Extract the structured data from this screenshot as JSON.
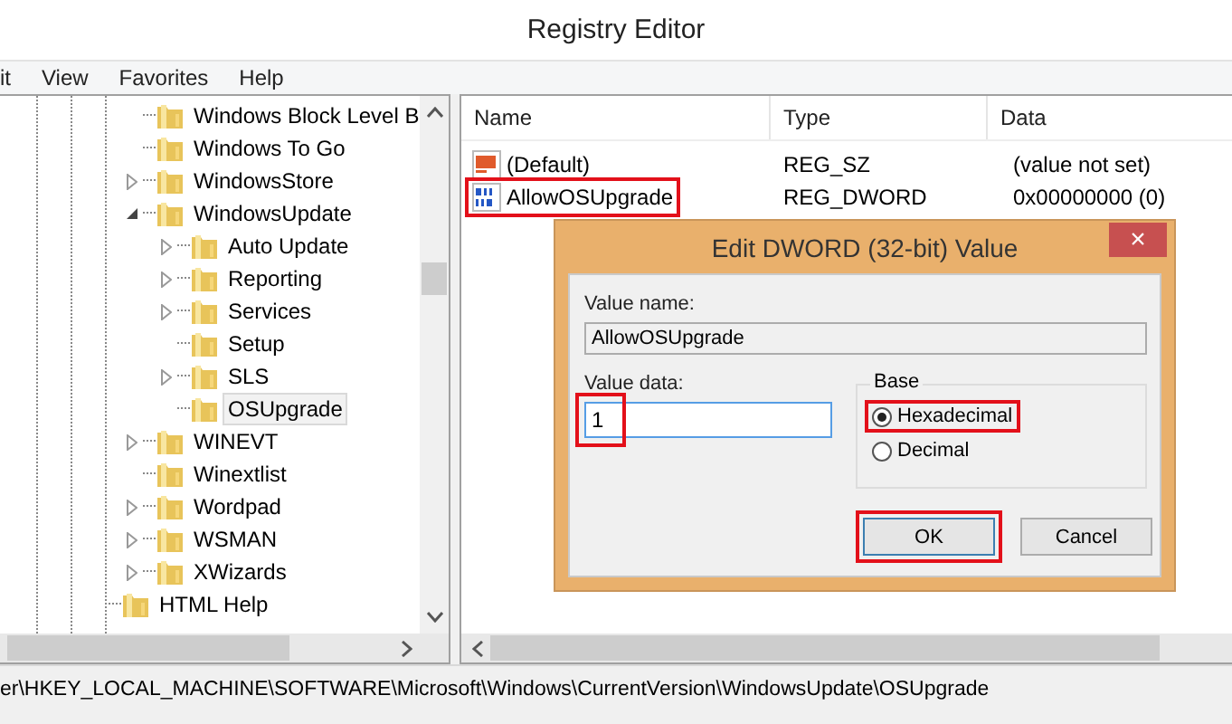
{
  "window": {
    "title": "Registry Editor"
  },
  "menu": [
    {
      "label": "it"
    },
    {
      "label": "View"
    },
    {
      "label": "Favorites"
    },
    {
      "label": "Help"
    }
  ],
  "tree": {
    "items": [
      {
        "label": "Windows Block Level B",
        "selected": false
      },
      {
        "label": "Windows To Go",
        "selected": false
      },
      {
        "label": "WindowsStore",
        "expanded": false,
        "selected": false
      },
      {
        "label": "WindowsUpdate",
        "expanded": true,
        "selected": false,
        "children": [
          {
            "label": "Auto Update",
            "expanded": false,
            "selected": false
          },
          {
            "label": "Reporting",
            "expanded": false,
            "selected": false
          },
          {
            "label": "Services",
            "expanded": false,
            "selected": false
          },
          {
            "label": "Setup",
            "selected": false
          },
          {
            "label": "SLS",
            "expanded": false,
            "selected": false
          },
          {
            "label": "OSUpgrade",
            "selected": true
          }
        ]
      },
      {
        "label": "WINEVT",
        "expanded": false,
        "selected": false
      },
      {
        "label": "Winextlist",
        "selected": false
      },
      {
        "label": "Wordpad",
        "expanded": false,
        "selected": false
      },
      {
        "label": "WSMAN",
        "expanded": false,
        "selected": false
      },
      {
        "label": "XWizards",
        "expanded": false,
        "selected": false
      }
    ],
    "outer_items": [
      {
        "label": "HTML Help",
        "selected": false
      }
    ]
  },
  "list": {
    "columns": [
      "Name",
      "Type",
      "Data"
    ],
    "rows": [
      {
        "kind": "string",
        "name": "(Default)",
        "type": "REG_SZ",
        "data": "(value not set)",
        "highlighted": false
      },
      {
        "kind": "dword",
        "name": "AllowOSUpgrade",
        "type": "REG_DWORD",
        "data": "0x00000000 (0)",
        "highlighted": true
      }
    ]
  },
  "dialog": {
    "title": "Edit DWORD (32-bit) Value",
    "close": "×",
    "value_name_label": "Value name:",
    "value_name": "AllowOSUpgrade",
    "value_data_label": "Value data:",
    "value_data": "1",
    "value_data_highlighted": true,
    "base_label": "Base",
    "base_options": [
      {
        "label": "Hexadecimal",
        "selected": true,
        "highlighted": true
      },
      {
        "label": "Decimal",
        "selected": false,
        "highlighted": false
      }
    ],
    "buttons": [
      {
        "label": "OK",
        "default": true,
        "highlighted": true
      },
      {
        "label": "Cancel",
        "default": false,
        "highlighted": false
      }
    ]
  },
  "status_bar": "er\\HKEY_LOCAL_MACHINE\\SOFTWARE\\Microsoft\\Windows\\CurrentVersion\\WindowsUpdate\\OSUpgrade"
}
